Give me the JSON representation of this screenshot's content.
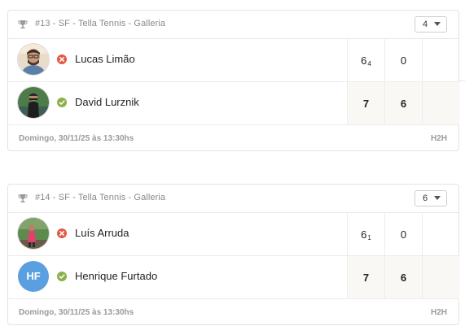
{
  "matches": [
    {
      "title": "#13 - SF - Tella Tennis - Galleria",
      "select_value": "4",
      "players": [
        {
          "name": "Lucas Limão",
          "status": "lost",
          "scores": [
            {
              "main": "6",
              "tb": "4"
            },
            {
              "main": "0",
              "tb": ""
            }
          ]
        },
        {
          "name": "David Lurznik",
          "status": "won",
          "scores": [
            {
              "main": "7",
              "tb": ""
            },
            {
              "main": "6",
              "tb": ""
            }
          ]
        }
      ],
      "date": "Domingo, 30/11/25 às 13:30hs",
      "h2h": "H2H"
    },
    {
      "title": "#14 - SF - Tella Tennis - Galleria",
      "select_value": "6",
      "players": [
        {
          "name": "Luís Arruda",
          "status": "lost",
          "scores": [
            {
              "main": "6",
              "tb": "1"
            },
            {
              "main": "0",
              "tb": ""
            }
          ]
        },
        {
          "name": "Henrique Furtado",
          "initials": "HF",
          "status": "won",
          "scores": [
            {
              "main": "7",
              "tb": ""
            },
            {
              "main": "6",
              "tb": ""
            }
          ]
        }
      ],
      "date": "Domingo, 30/11/25 às 13:30hs",
      "h2h": "H2H"
    }
  ],
  "colors": {
    "lost": "#e05a47",
    "won": "#8cb04a",
    "initials_bg": "#5aa0e0"
  },
  "icons": {
    "trophy": "trophy-icon",
    "lost": "close-circle-icon",
    "won": "check-circle-icon"
  }
}
